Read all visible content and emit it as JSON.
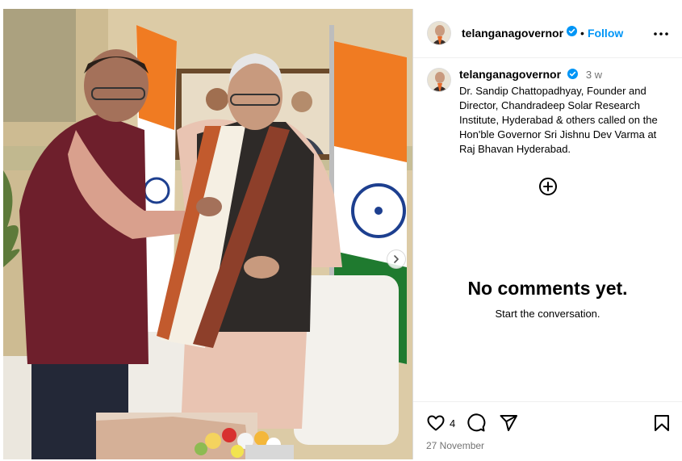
{
  "post": {
    "username": "telanganagovernor",
    "follow_label": "Follow",
    "separator": "•",
    "time_ago": "3 w",
    "caption": "Dr. Sandip Chattopadhyay, Founder and Director, Chandradeep Solar Research Institute, Hyderabad & others called on the Hon'ble Governor Sri Jishnu Dev Varma at Raj Bhavan Hyderabad.",
    "empty_title": "No comments yet.",
    "empty_subtitle": "Start the conversation.",
    "like_count": "4",
    "date": "27 November"
  },
  "icons": {
    "more": "more-options-icon",
    "verified": "verified-badge-icon",
    "add": "add-comment-icon",
    "like": "heart-icon",
    "comment": "comment-icon",
    "share": "share-icon",
    "save": "bookmark-icon",
    "next": "chevron-right-icon"
  },
  "colors": {
    "follow": "#0095f6",
    "verified": "#0095f6",
    "muted": "#737373",
    "border": "#dbdbdb"
  }
}
